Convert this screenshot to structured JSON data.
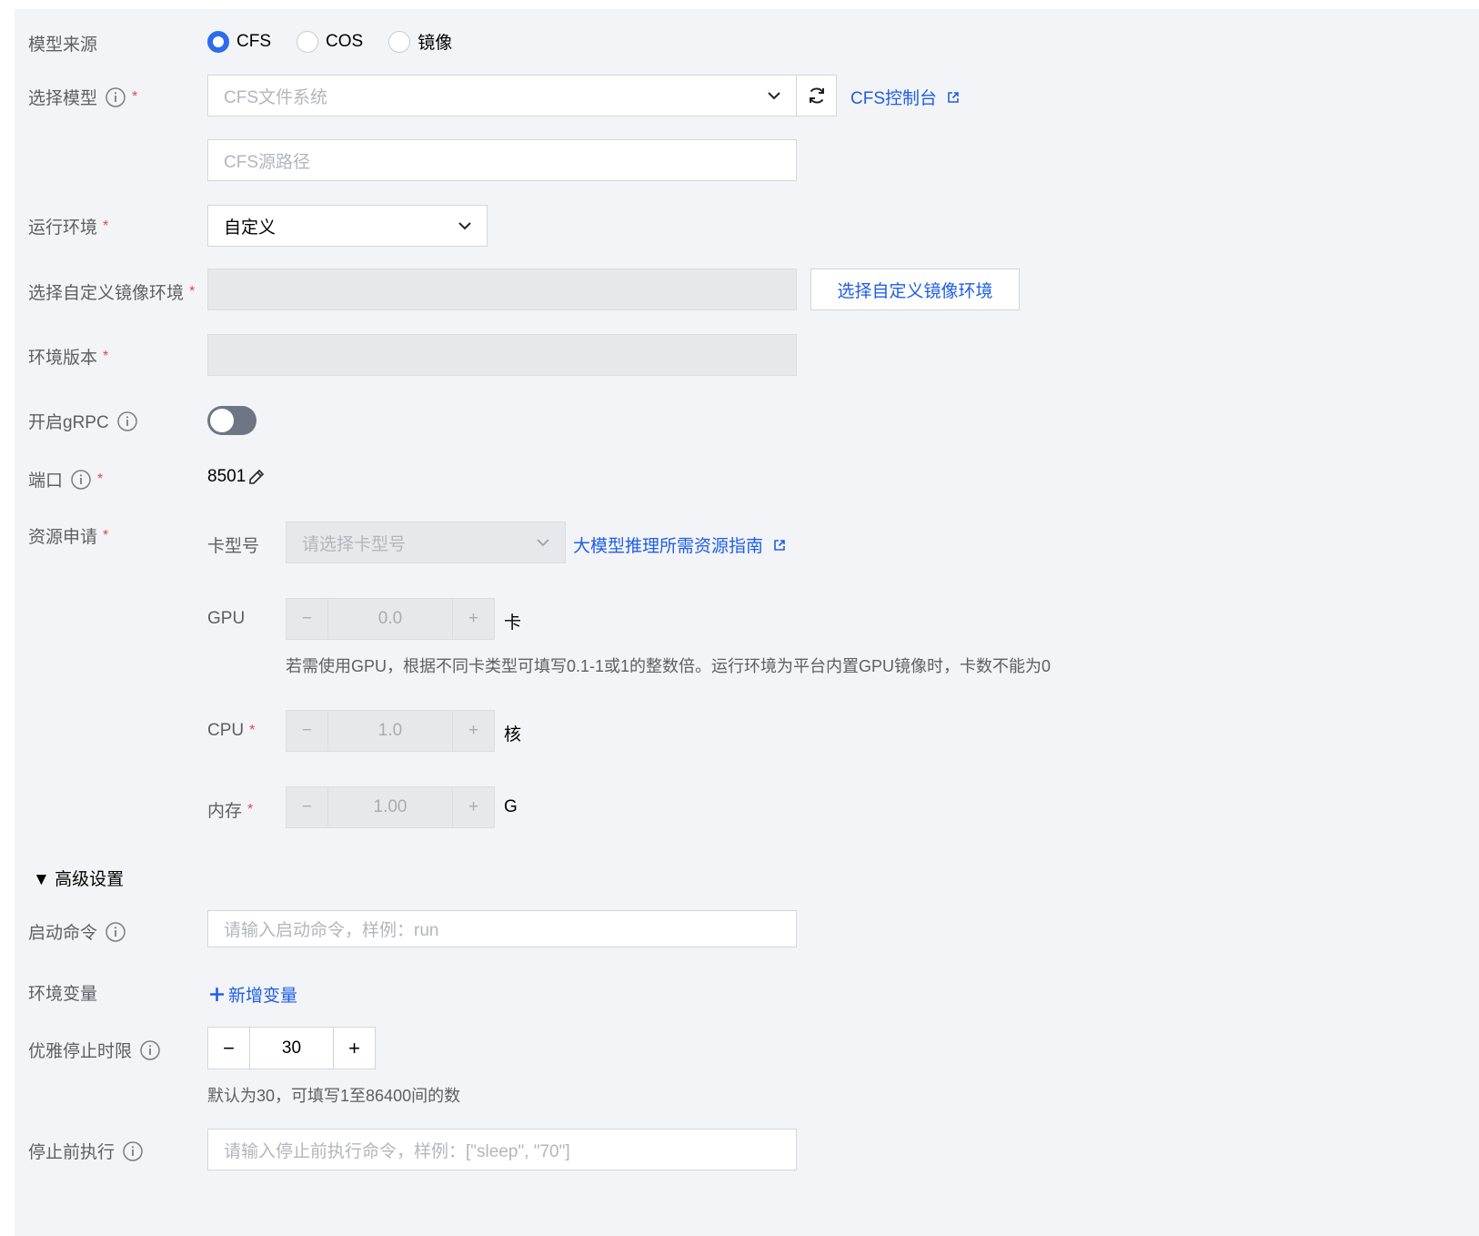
{
  "model_source": {
    "label": "模型来源",
    "options": [
      {
        "label": "CFS",
        "selected": true
      },
      {
        "label": "COS",
        "selected": false
      },
      {
        "label": "镜像",
        "selected": false
      }
    ]
  },
  "select_model": {
    "label": "选择模型",
    "required_mark": "*",
    "fs_placeholder": "CFS文件系统",
    "console_link": "CFS控制台",
    "path_placeholder": "CFS源路径"
  },
  "runtime_env": {
    "label": "运行环境",
    "required_mark": "*",
    "value": "自定义"
  },
  "custom_image": {
    "label": "选择自定义镜像环境",
    "required_mark": "*",
    "button_label": "选择自定义镜像环境"
  },
  "env_version": {
    "label": "环境版本",
    "required_mark": "*"
  },
  "grpc": {
    "label": "开启gRPC",
    "enabled": false
  },
  "port": {
    "label": "端口",
    "required_mark": "*",
    "value": "8501"
  },
  "resources": {
    "label": "资源申请",
    "required_mark": "*",
    "card_type": {
      "label": "卡型号",
      "placeholder": "请选择卡型号",
      "guide_link": "大模型推理所需资源指南"
    },
    "gpu": {
      "label": "GPU",
      "value": "0.0",
      "unit": "卡",
      "hint": "若需使用GPU，根据不同卡类型可填写0.1-1或1的整数倍。运行环境为平台内置GPU镜像时，卡数不能为0"
    },
    "cpu": {
      "label": "CPU",
      "required_mark": "*",
      "value": "1.0",
      "unit": "核"
    },
    "memory": {
      "label": "内存",
      "required_mark": "*",
      "value": "1.00",
      "unit": "G"
    }
  },
  "advanced": {
    "toggle_label": "▼ 高级设置",
    "start_cmd": {
      "label": "启动命令",
      "placeholder": "请输入启动命令，样例：run"
    },
    "env_vars": {
      "label": "环境变量",
      "add_label": "新增变量"
    },
    "grace_period": {
      "label": "优雅停止时限",
      "value": "30",
      "minus": "−",
      "plus": "+",
      "hint": "默认为30，可填写1至86400间的数"
    },
    "pre_stop": {
      "label": "停止前执行",
      "placeholder": "请输入停止前执行命令，样例：[\"sleep\", \"70\"]"
    }
  },
  "stepper_symbols": {
    "minus": "−",
    "plus": "+"
  },
  "colors": {
    "accent": "#2d6bea",
    "link": "#1f5ee6",
    "required": "#e54545",
    "panel_bg": "#f3f4f7"
  }
}
